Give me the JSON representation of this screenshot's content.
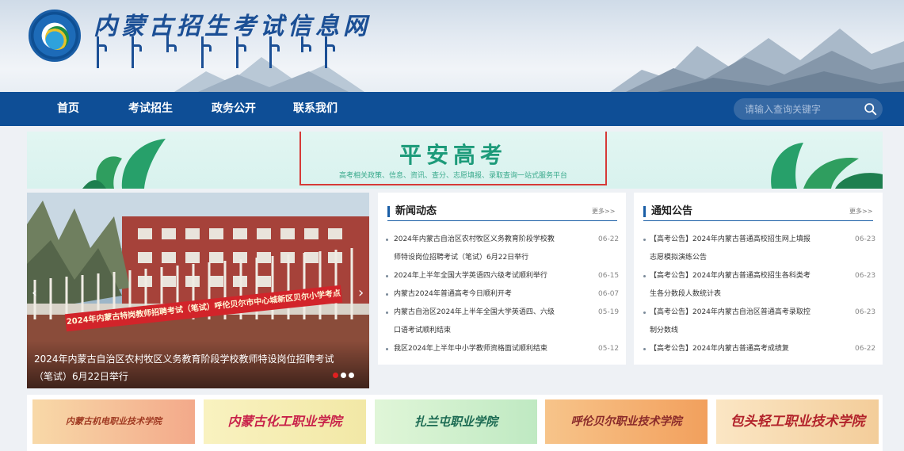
{
  "header": {
    "site_title": "内蒙古招生考试信息网"
  },
  "nav": {
    "items": [
      {
        "label": "首页"
      },
      {
        "label": "考试招生"
      },
      {
        "label": "政务公开"
      },
      {
        "label": "联系我们"
      }
    ],
    "search_placeholder": "请输入查询关键字"
  },
  "banner": {
    "title": "平安高考",
    "subtitle": "高考相关政策、信息、资讯、查分、志愿填报、录取查询一站式服务平台"
  },
  "slideshow": {
    "photo_banner_text": "2024年内蒙古特岗教师招聘考试（笔试）呼伦贝尔市中心城新区贝尔小学考点",
    "caption": "2024年内蒙古自治区农村牧区义务教育阶段学校教师特设岗位招聘考试（笔试）6月22日举行",
    "prev_arrow": "‹",
    "next_arrow": "›",
    "dot_count": 3,
    "active_dot": 1
  },
  "news": {
    "title": "新闻动态",
    "more": "更多>>",
    "items": [
      {
        "line1": "2024年内蒙古自治区农村牧区义务教育阶段学校教",
        "line2": "师特设岗位招聘考试（笔试）6月22日举行",
        "date": "06-22"
      },
      {
        "line1": "2024年上半年全国大学英语四六级考试顺利举行",
        "line2": "",
        "date": "06-15"
      },
      {
        "line1": "内蒙古2024年普通高考今日顺利开考",
        "line2": "",
        "date": "06-07"
      },
      {
        "line1": "内蒙古自治区2024年上半年全国大学英语四、六级",
        "line2": "口语考试顺利结束",
        "date": "05-19"
      },
      {
        "line1": "我区2024年上半年中小学教师资格面试顺利结束",
        "line2": "",
        "date": "05-12"
      }
    ]
  },
  "notices": {
    "title": "通知公告",
    "more": "更多>>",
    "items": [
      {
        "line1": "【高考公告】2024年内蒙古普通高校招生网上填报",
        "line2": "志愿模拟演练公告",
        "date": "06-23"
      },
      {
        "line1": "【高考公告】2024年内蒙古普通高校招生各科类考",
        "line2": "生各分数段人数统计表",
        "date": "06-23"
      },
      {
        "line1": "【高考公告】2024年内蒙古自治区普通高考录取控",
        "line2": "制分数线",
        "date": "06-23"
      },
      {
        "line1": "【高考公告】2024年内蒙古普通高考成绩复",
        "line2": "",
        "date": "06-22"
      }
    ]
  },
  "schools": [
    {
      "name": "内蒙古机电职业技术学院",
      "color": "#b03a22",
      "bg": "#f6c6a0"
    },
    {
      "name": "内蒙古化工职业学院",
      "color": "#c8224a",
      "bg": "#f5f0b8"
    },
    {
      "name": "扎兰屯职业学院",
      "color": "#1b6a52",
      "bg": "#d4f2d0"
    },
    {
      "name": "呼伦贝尔职业技术学院",
      "color": "#8a2a2a",
      "bg": "#f4b677"
    },
    {
      "name": "包头轻工职业技术学院",
      "color": "#b2222a",
      "bg": "#f7dcb2"
    }
  ]
}
